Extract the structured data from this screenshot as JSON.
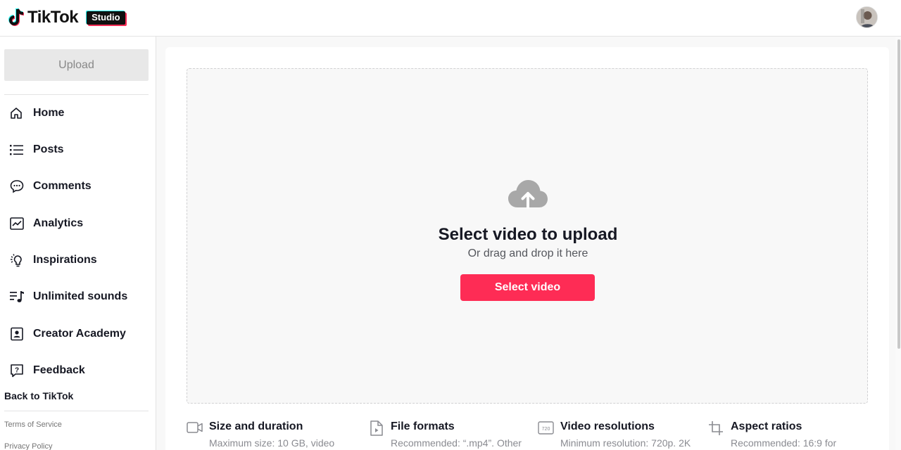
{
  "header": {
    "logo_text": "TikTok",
    "badge": "Studio",
    "avatar_icon": "user-avatar"
  },
  "sidebar": {
    "upload_label": "Upload",
    "items": [
      {
        "label": "Home",
        "icon": "home-icon"
      },
      {
        "label": "Posts",
        "icon": "list-icon"
      },
      {
        "label": "Comments",
        "icon": "comment-icon"
      },
      {
        "label": "Analytics",
        "icon": "chart-icon"
      },
      {
        "label": "Inspirations",
        "icon": "lightbulb-icon"
      },
      {
        "label": "Unlimited sounds",
        "icon": "music-list-icon"
      },
      {
        "label": "Creator Academy",
        "icon": "academy-icon"
      },
      {
        "label": "Feedback",
        "icon": "feedback-icon"
      }
    ],
    "back_link": "Back to TikTok",
    "terms": "Terms of Service",
    "privacy": "Privacy Policy"
  },
  "upload": {
    "title": "Select video to upload",
    "subtitle": "Or drag and drop it here",
    "button": "Select video"
  },
  "info": [
    {
      "title": "Size and duration",
      "desc": "Maximum size: 10 GB, video",
      "icon": "video-camera-icon"
    },
    {
      "title": "File formats",
      "desc": "Recommended: “.mp4”. Other",
      "icon": "file-icon"
    },
    {
      "title": "Video resolutions",
      "desc": "Minimum resolution: 720p. 2K",
      "icon": "resolution-icon",
      "icon_text": "720"
    },
    {
      "title": "Aspect ratios",
      "desc": "Recommended: 16:9 for",
      "icon": "crop-icon"
    }
  ],
  "colors": {
    "accent": "#fe2c55",
    "text": "#161823",
    "muted": "#8a8b91"
  }
}
